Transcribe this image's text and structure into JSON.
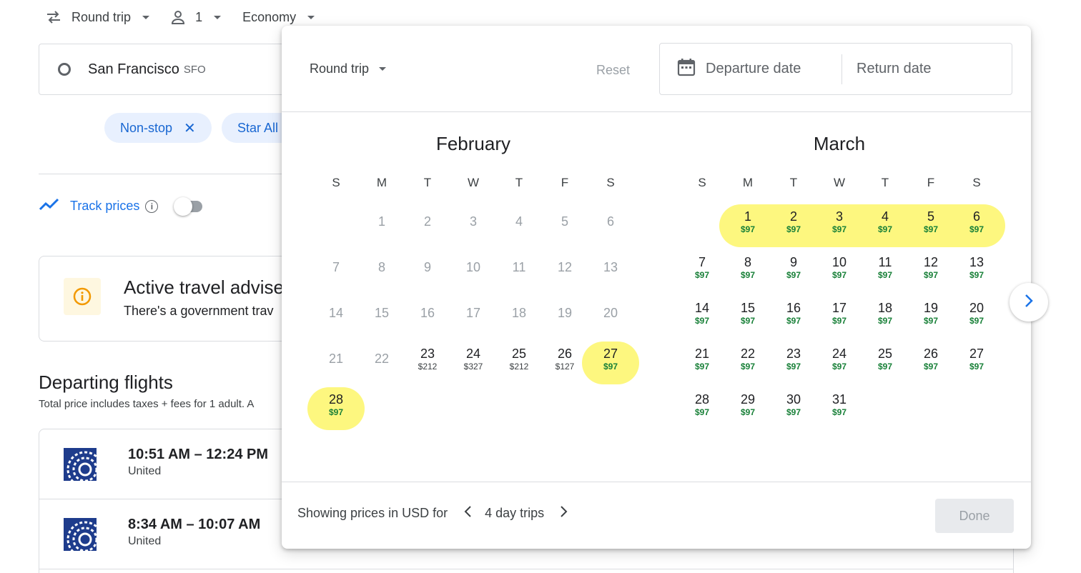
{
  "topbar": {
    "trip_type": "Round trip",
    "passengers": "1",
    "cabin": "Economy"
  },
  "origin": {
    "city": "San Francisco",
    "code": "SFO"
  },
  "filters": [
    {
      "label": "Non-stop",
      "close": "✕"
    },
    {
      "label": "Star All"
    }
  ],
  "track_prices": {
    "label": "Track prices",
    "info": "i"
  },
  "advisory": {
    "title": "Active travel advise",
    "text": "There's a government trav"
  },
  "departing": {
    "title": "Departing flights",
    "subtitle": "Total price includes taxes + fees for 1 adult. A",
    "flights": [
      {
        "times": "10:51 AM – 12:24 PM",
        "airline": "United"
      },
      {
        "times": "8:34 AM – 10:07 AM",
        "airline": "United"
      }
    ]
  },
  "picker": {
    "trip_type": "Round trip",
    "reset": "Reset",
    "departure_placeholder": "Departure date",
    "return_placeholder": "Return date",
    "weekdays": [
      "S",
      "M",
      "T",
      "W",
      "T",
      "F",
      "S"
    ],
    "months": [
      {
        "name": "February",
        "start_weekday": 1,
        "highlight_days": [
          27,
          28
        ],
        "days": [
          {
            "d": "1",
            "past": true
          },
          {
            "d": "2",
            "past": true
          },
          {
            "d": "3",
            "past": true
          },
          {
            "d": "4",
            "past": true
          },
          {
            "d": "5",
            "past": true
          },
          {
            "d": "6",
            "past": true
          },
          {
            "d": "7",
            "past": true
          },
          {
            "d": "8",
            "past": true
          },
          {
            "d": "9",
            "past": true
          },
          {
            "d": "10",
            "past": true
          },
          {
            "d": "11",
            "past": true
          },
          {
            "d": "12",
            "past": true
          },
          {
            "d": "13",
            "past": true
          },
          {
            "d": "14",
            "past": true
          },
          {
            "d": "15",
            "past": true
          },
          {
            "d": "16",
            "past": true
          },
          {
            "d": "17",
            "past": true
          },
          {
            "d": "18",
            "past": true
          },
          {
            "d": "19",
            "past": true
          },
          {
            "d": "20",
            "past": true
          },
          {
            "d": "21",
            "past": true
          },
          {
            "d": "22",
            "past": true
          },
          {
            "d": "23",
            "price": "$212"
          },
          {
            "d": "24",
            "price": "$327"
          },
          {
            "d": "25",
            "price": "$212"
          },
          {
            "d": "26",
            "price": "$127"
          },
          {
            "d": "27",
            "price": "$97",
            "low": true
          },
          {
            "d": "28",
            "price": "$97",
            "low": true
          }
        ]
      },
      {
        "name": "March",
        "start_weekday": 1,
        "highlight_days": [
          1,
          2,
          3,
          4,
          5,
          6
        ],
        "days": [
          {
            "d": "1",
            "price": "$97",
            "low": true
          },
          {
            "d": "2",
            "price": "$97",
            "low": true
          },
          {
            "d": "3",
            "price": "$97",
            "low": true
          },
          {
            "d": "4",
            "price": "$97",
            "low": true
          },
          {
            "d": "5",
            "price": "$97",
            "low": true
          },
          {
            "d": "6",
            "price": "$97",
            "low": true
          },
          {
            "d": "7",
            "price": "$97",
            "low": true
          },
          {
            "d": "8",
            "price": "$97",
            "low": true
          },
          {
            "d": "9",
            "price": "$97",
            "low": true
          },
          {
            "d": "10",
            "price": "$97",
            "low": true
          },
          {
            "d": "11",
            "price": "$97",
            "low": true
          },
          {
            "d": "12",
            "price": "$97",
            "low": true
          },
          {
            "d": "13",
            "price": "$97",
            "low": true
          },
          {
            "d": "14",
            "price": "$97",
            "low": true
          },
          {
            "d": "15",
            "price": "$97",
            "low": true
          },
          {
            "d": "16",
            "price": "$97",
            "low": true
          },
          {
            "d": "17",
            "price": "$97",
            "low": true
          },
          {
            "d": "18",
            "price": "$97",
            "low": true
          },
          {
            "d": "19",
            "price": "$97",
            "low": true
          },
          {
            "d": "20",
            "price": "$97",
            "low": true
          },
          {
            "d": "21",
            "price": "$97",
            "low": true
          },
          {
            "d": "22",
            "price": "$97",
            "low": true
          },
          {
            "d": "23",
            "price": "$97",
            "low": true
          },
          {
            "d": "24",
            "price": "$97",
            "low": true
          },
          {
            "d": "25",
            "price": "$97",
            "low": true
          },
          {
            "d": "26",
            "price": "$97",
            "low": true
          },
          {
            "d": "27",
            "price": "$97",
            "low": true
          },
          {
            "d": "28",
            "price": "$97",
            "low": true
          },
          {
            "d": "29",
            "price": "$97",
            "low": true
          },
          {
            "d": "30",
            "price": "$97",
            "low": true
          },
          {
            "d": "31",
            "price": "$97",
            "low": true
          }
        ]
      }
    ],
    "footer": {
      "showing": "Showing prices in USD for",
      "trip_length": "4 day trips"
    },
    "done": "Done"
  },
  "colors": {
    "accent": "#1a73e8",
    "highlight": "#fdf77f",
    "low_price": "#188038",
    "chip_bg": "#e8f0fe"
  }
}
